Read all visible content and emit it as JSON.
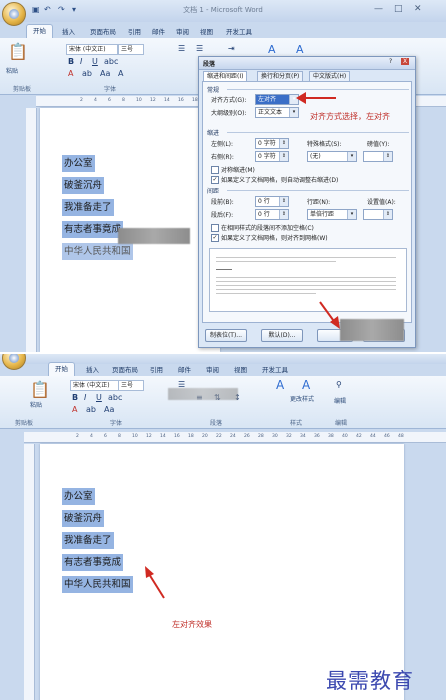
{
  "top": {
    "window_title": "文档 1 - Microsoft Word",
    "tabs": [
      "开始",
      "插入",
      "页面布局",
      "引用",
      "邮件",
      "审阅",
      "视图",
      "开发工具"
    ],
    "font_name": "宋体 (中文正)",
    "font_size": "三号",
    "paste_label": "粘贴",
    "group_labels": [
      "剪贴板",
      "字体"
    ],
    "ruler_ticks": [
      "2",
      "4",
      "6",
      "8",
      "10",
      "12",
      "14",
      "16",
      "18",
      "20",
      "22"
    ]
  },
  "dialog": {
    "title": "段落",
    "tabs": [
      "缩进和间距(I)",
      "换行和分页(P)",
      "中文版式(H)"
    ],
    "section_general": "常规",
    "align_label": "对齐方式(G):",
    "align_value": "左对齐",
    "outline_label": "大纲级别(O):",
    "outline_value": "正文文本",
    "section_indent": "缩进",
    "left_label": "左侧(L):",
    "left_value": "0 字符",
    "right_label": "右侧(R):",
    "right_value": "0 字符",
    "special_label": "特殊格式(S):",
    "special_value": "(无)",
    "measure_label": "磅值(Y):",
    "mirror_label": "对称缩进(M)",
    "grid_indent_label": "如果定义了文档网格，则自动调整右缩进(D)",
    "section_spacing": "间距",
    "before_label": "段前(B):",
    "before_value": "0 行",
    "after_label": "段后(F):",
    "after_value": "0 行",
    "line_label": "行距(N):",
    "line_value": "单倍行距",
    "setting_label": "设置值(A):",
    "no_space_label": "在相同样式的段落间不添加空格(C)",
    "snap_label": "如果定义了文档网格，则对齐到网格(W)",
    "tabs_button": "制表位(T)...",
    "default_button": "默认(D)...",
    "close_glyph": "X"
  },
  "annotation_top": "对齐方式选择，左对齐",
  "lines": [
    "办公室",
    "破釜沉舟",
    "我准备走了",
    "有志者事竟成",
    "中华人民共和国"
  ],
  "bottom": {
    "tabs": [
      "开始",
      "插入",
      "页面布局",
      "引用",
      "邮件",
      "审阅",
      "视图",
      "开发工具"
    ],
    "font_name": "宋体 (中文正)",
    "font_size": "三号",
    "paste_label": "粘贴",
    "group_labels": [
      "剪贴板",
      "字体",
      "段落",
      "样式",
      "编辑"
    ],
    "change_style": "更改样式",
    "edit_label": "编辑",
    "ruler_ticks": [
      "2",
      "4",
      "6",
      "8",
      "10",
      "12",
      "14",
      "16",
      "18",
      "20",
      "22",
      "24",
      "26",
      "28",
      "30",
      "32",
      "34",
      "36",
      "38",
      "40",
      "42",
      "44",
      "46",
      "48"
    ]
  },
  "annotation_bottom": "左对齐效果",
  "watermark": "最需教育",
  "colors": {
    "accent_red": "#c0302a",
    "highlight": "#95b4e2",
    "ribbon_blue": "#c9d9ee",
    "brand_blue": "#3c49b0"
  }
}
